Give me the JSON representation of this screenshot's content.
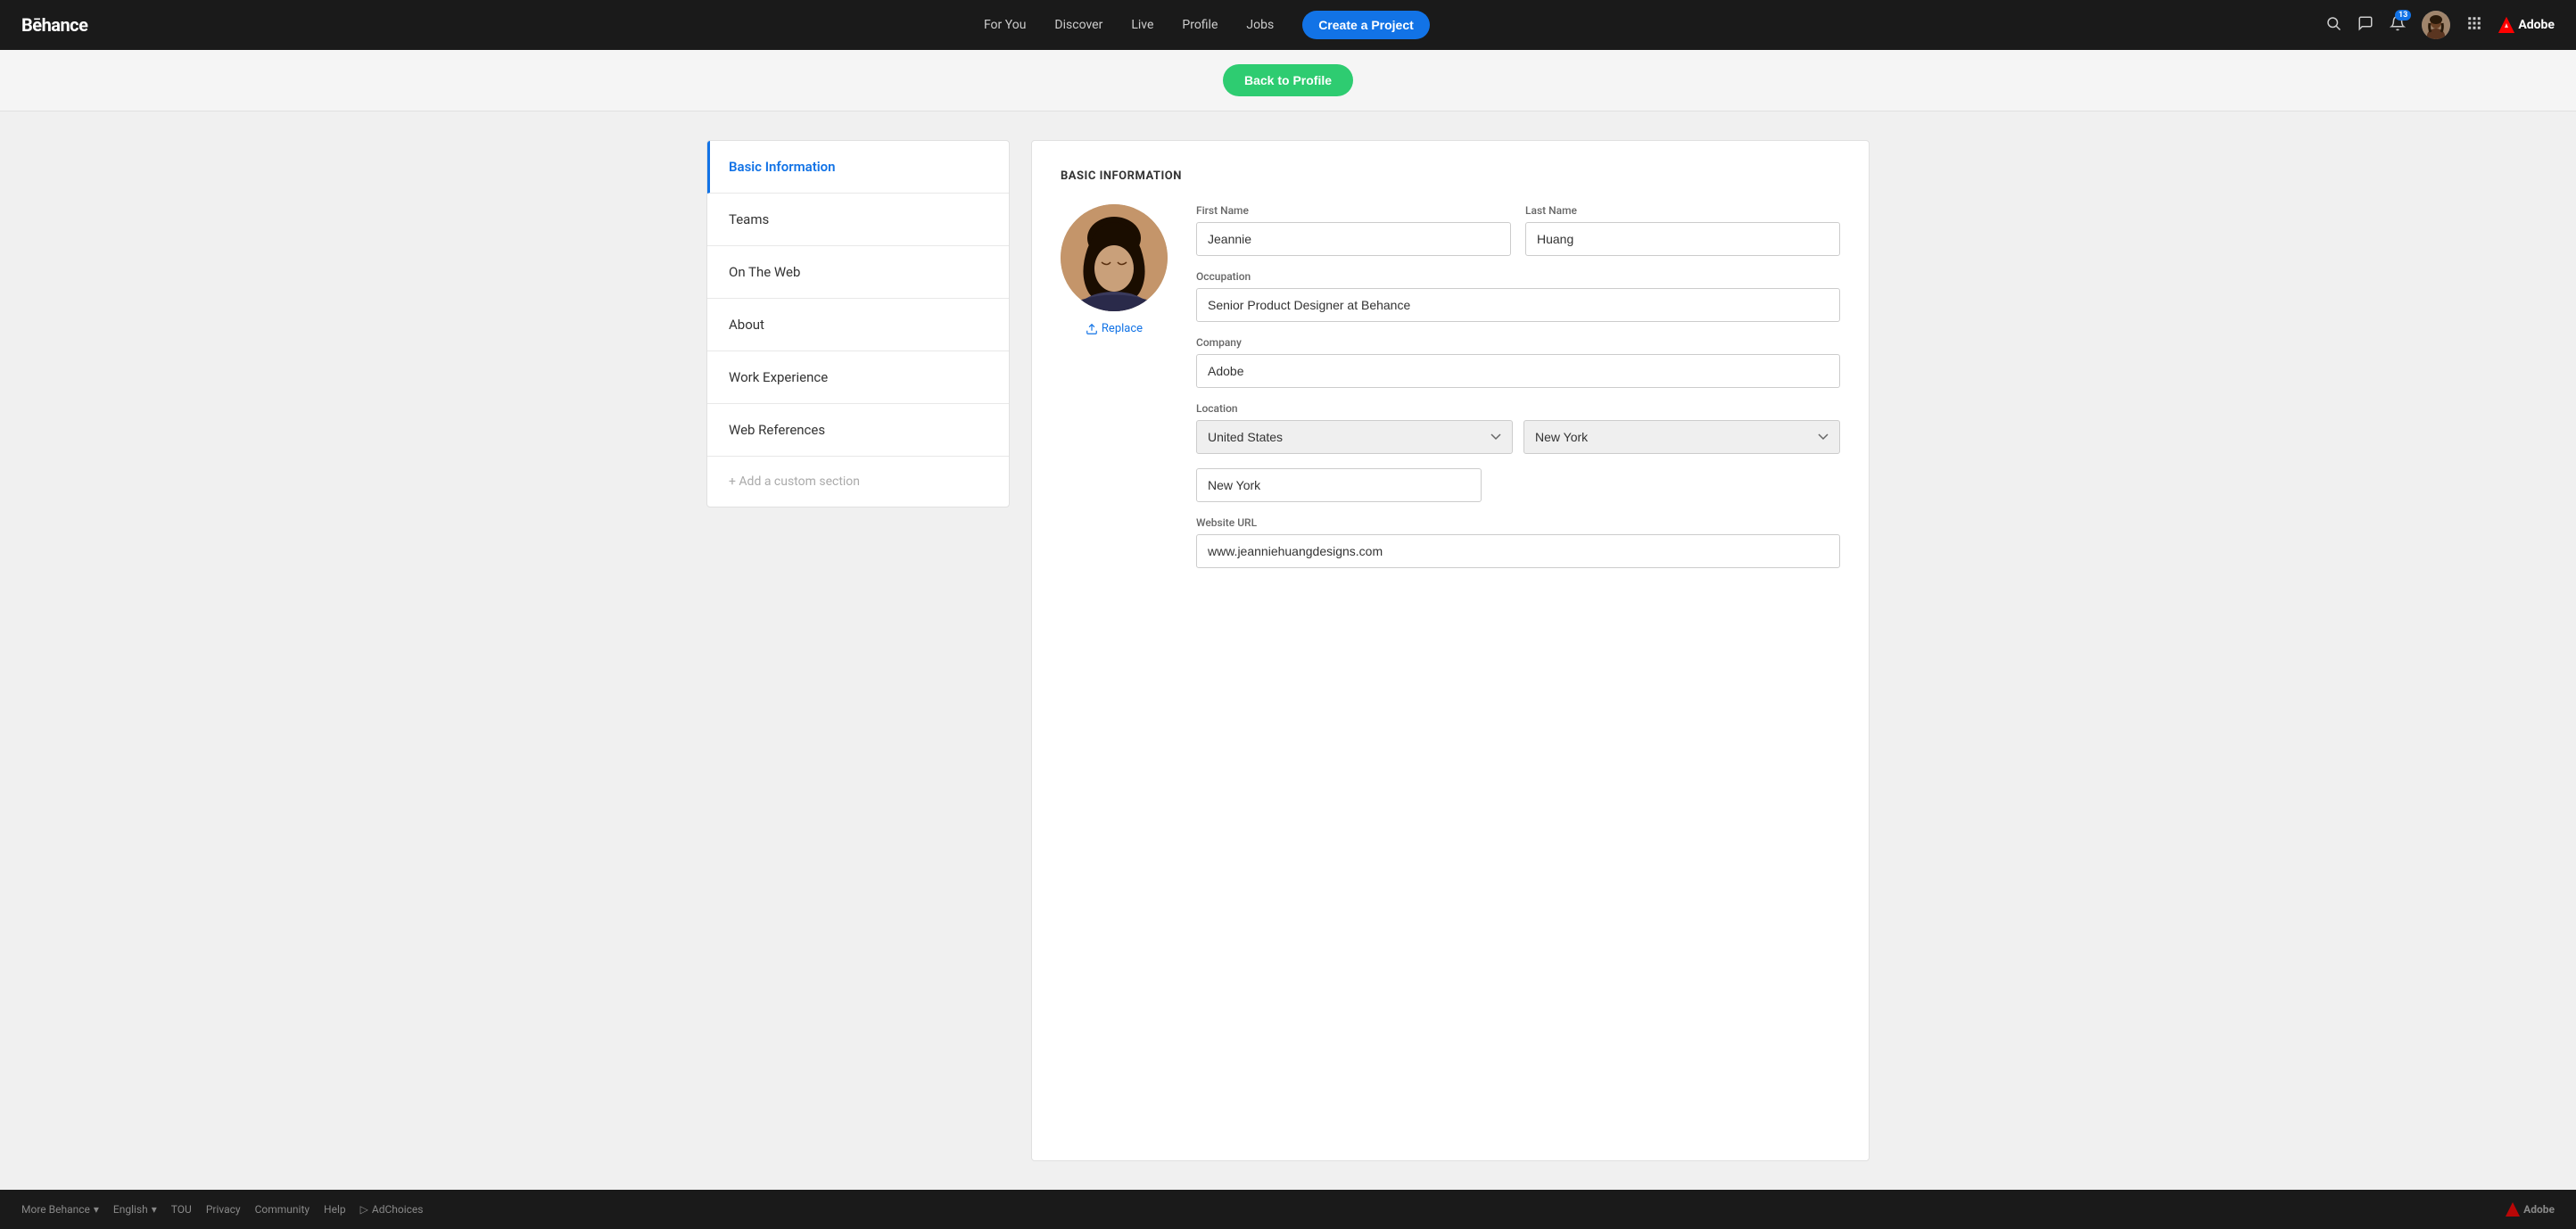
{
  "header": {
    "logo": "Bēhance",
    "nav": [
      {
        "label": "For You",
        "id": "for-you"
      },
      {
        "label": "Discover",
        "id": "discover"
      },
      {
        "label": "Live",
        "id": "live"
      },
      {
        "label": "Profile",
        "id": "profile"
      },
      {
        "label": "Jobs",
        "id": "jobs"
      }
    ],
    "create_btn": "Create a Project",
    "notification_count": "13",
    "adobe_label": "Adobe"
  },
  "back_bar": {
    "button_label": "Back to Profile"
  },
  "sidebar": {
    "items": [
      {
        "label": "Basic Information",
        "id": "basic-info",
        "active": true
      },
      {
        "label": "Teams",
        "id": "teams",
        "active": false
      },
      {
        "label": "On The Web",
        "id": "on-the-web",
        "active": false
      },
      {
        "label": "About",
        "id": "about",
        "active": false
      },
      {
        "label": "Work Experience",
        "id": "work-experience",
        "active": false
      },
      {
        "label": "Web References",
        "id": "web-references",
        "active": false
      }
    ],
    "add_custom": "+ Add a custom section"
  },
  "form": {
    "section_title": "BASIC INFORMATION",
    "replace_label": "Replace",
    "fields": {
      "first_name_label": "First Name",
      "first_name_value": "Jeannie",
      "last_name_label": "Last Name",
      "last_name_value": "Huang",
      "occupation_label": "Occupation",
      "occupation_value": "Senior Product Designer at Behance",
      "company_label": "Company",
      "company_value": "Adobe",
      "location_label": "Location",
      "country_value": "United States",
      "state_value": "New York",
      "city_value": "New York",
      "website_label": "Website URL",
      "website_value": "www.jeanniehuangdesigns.com"
    }
  },
  "footer": {
    "more_behance": "More Behance",
    "language": "English",
    "links": [
      "TOU",
      "Privacy",
      "Community",
      "Help"
    ],
    "adchoices": "AdChoices",
    "adobe_label": "Adobe"
  }
}
